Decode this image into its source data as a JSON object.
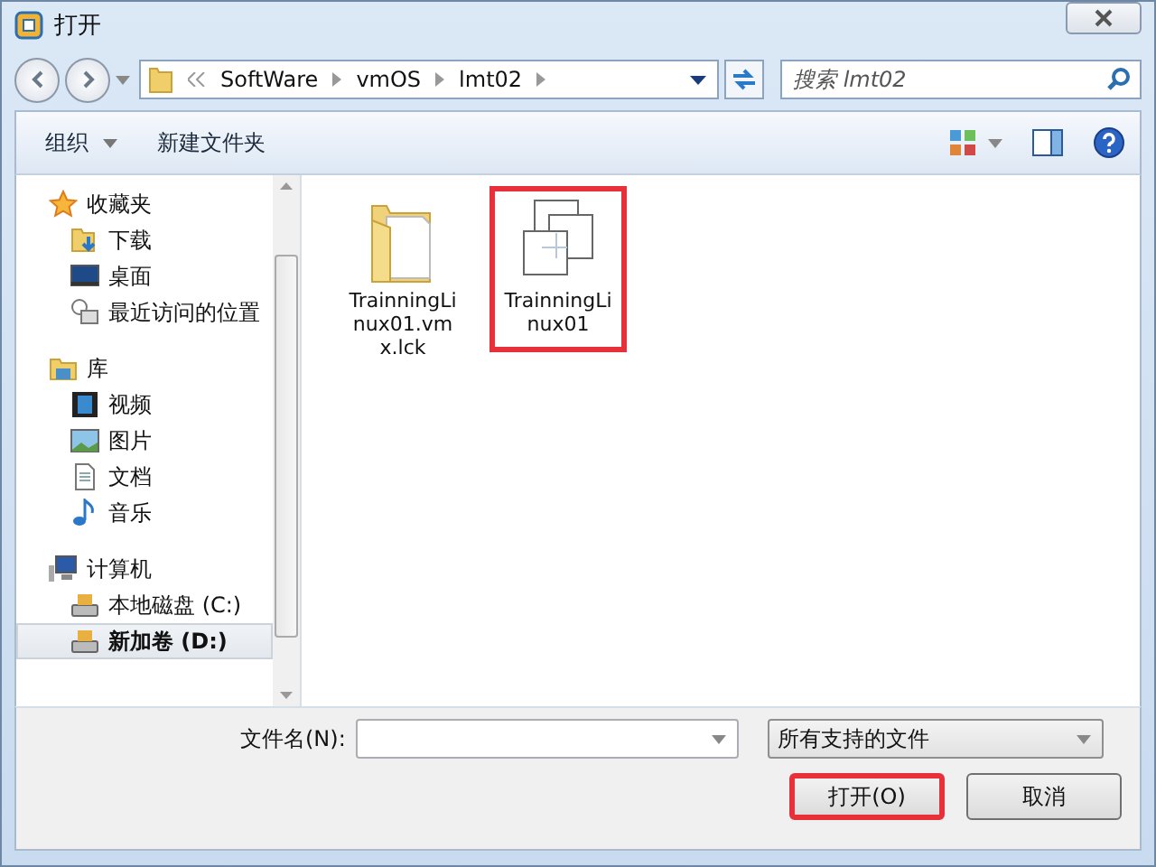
{
  "window": {
    "title": "打开"
  },
  "address": {
    "breadcrumb": [
      "SoftWare",
      "vmOS",
      "lmt02"
    ]
  },
  "search": {
    "placeholder": "搜索 lmt02"
  },
  "toolbar": [
    {
      "label": "组织",
      "dropdown": true
    },
    {
      "label": "新建文件夹",
      "dropdown": false
    }
  ],
  "sidebar": [
    {
      "label": "收藏夹",
      "kind": "star",
      "selected": false,
      "children": [
        {
          "label": "下载",
          "kind": "download",
          "selected": false
        },
        {
          "label": "桌面",
          "kind": "desktop",
          "selected": false
        },
        {
          "label": "最近访问的位置",
          "kind": "recent",
          "selected": false
        }
      ]
    },
    {
      "label": "库",
      "kind": "library",
      "selected": false,
      "children": [
        {
          "label": "视频",
          "kind": "video",
          "selected": false
        },
        {
          "label": "图片",
          "kind": "picture",
          "selected": false
        },
        {
          "label": "文档",
          "kind": "document",
          "selected": false
        },
        {
          "label": "音乐",
          "kind": "music",
          "selected": false
        }
      ]
    },
    {
      "label": "计算机",
      "kind": "computer",
      "selected": false,
      "children": [
        {
          "label": "本地磁盘 (C:)",
          "kind": "drive",
          "selected": false
        },
        {
          "label": "新加卷 (D:)",
          "kind": "drive",
          "selected": true
        }
      ]
    }
  ],
  "files": [
    {
      "name": "TrainningLinux01.vmx.lck",
      "kind": "folder",
      "highlighted": false
    },
    {
      "name": "TrainningLinux01",
      "kind": "vm",
      "highlighted": true
    }
  ],
  "filename": {
    "label": "文件名(N):"
  },
  "filetype": {
    "value": "所有支持的文件"
  },
  "buttons": [
    {
      "label": "打开(O)",
      "highlighted": true
    },
    {
      "label": "取消",
      "highlighted": false
    }
  ]
}
